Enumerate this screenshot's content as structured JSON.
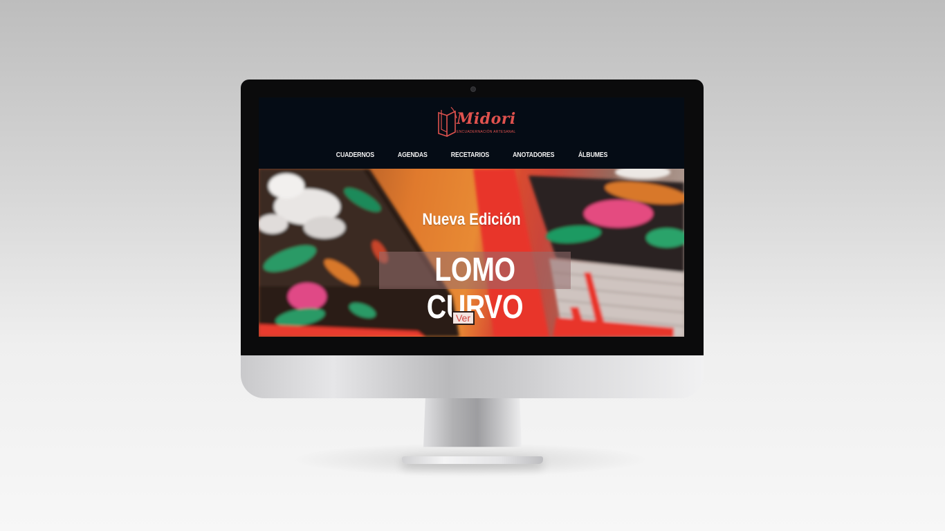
{
  "site": {
    "logo_text": "Midori",
    "logo_tagline": "ENCUADERNACIÓN ARTESANAL"
  },
  "nav": {
    "items": [
      {
        "label": "CUADERNOS"
      },
      {
        "label": "AGENDAS"
      },
      {
        "label": "RECETARIOS"
      },
      {
        "label": "ANOTADORES"
      },
      {
        "label": "ÁLBUMES"
      }
    ]
  },
  "hero": {
    "subtitle": "Nueva Edición",
    "title": "LOMO CURVO",
    "button_label": "Ver"
  },
  "colors": {
    "brand": "#e0524e",
    "header_bg": "#050c15",
    "button_bg": "#f3e4e0"
  },
  "icons": {
    "logo": "open-book-icon",
    "camera": "camera-icon"
  }
}
